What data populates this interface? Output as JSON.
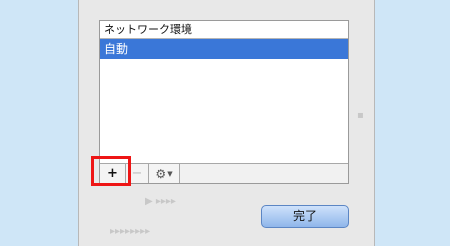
{
  "network_panel": {
    "list_header": "ネットワーク環境",
    "items": [
      {
        "label": "自動",
        "selected": true
      }
    ],
    "toolbar": {
      "add_label": "+",
      "remove_label": "−",
      "gear_icon": "gear-icon",
      "menu_caret": "chevron-down-icon"
    }
  },
  "done_label": "完了",
  "colors": {
    "selection": "#3a77d8",
    "highlight": "#ee1515",
    "page_background": "#cfe6f7"
  }
}
